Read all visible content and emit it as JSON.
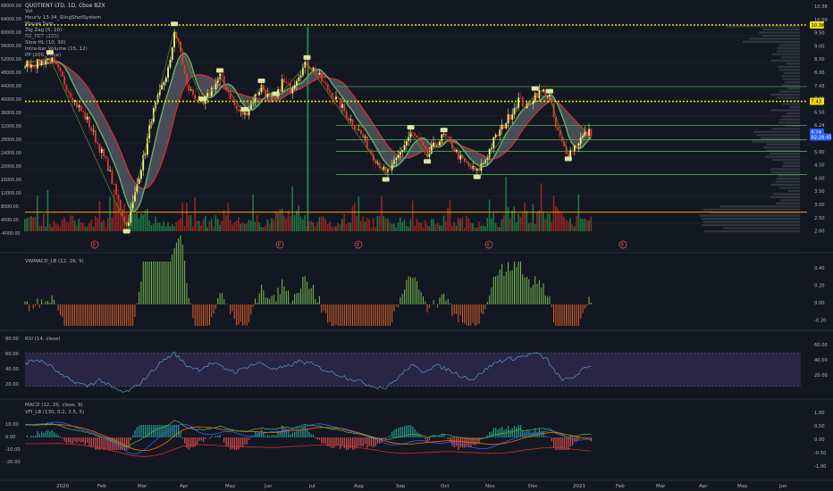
{
  "header": {
    "title": "QUOTIENT LTD, 1D, Cboe BZX",
    "indicators": [
      "Vol",
      "Hourly 13-34_SlingShotSystem",
      "Mouse Sym",
      "Zig Zag (5, 10)",
      "RB_MFP (100)",
      "Slow HL (10, 30)",
      "Intra-bar Volume (15, 12)",
      "PP (200, Price)"
    ]
  },
  "colors": {
    "background": "#131722",
    "bull": "#26a69a",
    "bear": "#ef5350",
    "vol_bull": "#1e8c45",
    "vol_bear": "#b0281e",
    "yellow_level": "#f0e20a",
    "green_level": "#4caf50",
    "orange_level": "#ff9800",
    "ma_red": "#d32f2f",
    "ma_green": "#66bb6a",
    "rsi_band": "#7e57c2",
    "rsi_line": "#5b9bd5"
  },
  "chart_data": [
    {
      "type": "candlestick",
      "title": "QUOTIENT LTD, 1D, Cboe BZX",
      "x_ticks": [
        "2020",
        "Feb",
        "Mar",
        "Apr",
        "May",
        "Jun",
        "Jul",
        "Aug",
        "Sep",
        "Oct",
        "Nov",
        "Dec",
        "2021",
        "Feb",
        "Mar",
        "Apr",
        "May",
        "Jun"
      ],
      "price_axis": [
        "10.38",
        "10.00",
        "9.50",
        "9.00",
        "8.50",
        "8.00",
        "7.43",
        "7.00",
        "6.50",
        "6.24",
        "5.50",
        "5.00",
        "4.50",
        "4.00",
        "3.50",
        "3.00",
        "2.50",
        "2.00"
      ],
      "price_badges": [
        {
          "text": "10.38",
          "price": 10.38,
          "style": "yellow"
        },
        {
          "text": "7.43",
          "price": 7.43,
          "style": "yellow"
        },
        {
          "text": "6.24",
          "price": 6.24,
          "style": "blue"
        },
        {
          "text": "02:28:45",
          "price": 6.05,
          "style": "blue"
        }
      ],
      "volume_axis": [
        "68000.00",
        "64000.00",
        "60000.00",
        "56000.00",
        "52000.00",
        "48000.00",
        "44000.00",
        "40000.00",
        "36000.00",
        "32000.00",
        "28000.00",
        "24000.00",
        "20000.00",
        "16000.00",
        "12000.00",
        "8000.00",
        "4000.00",
        "-4000.00"
      ],
      "close_series": [
        [
          0,
          8.9
        ],
        [
          5,
          8.85
        ],
        [
          9,
          9.0
        ],
        [
          12,
          9.1
        ],
        [
          16,
          8.6
        ],
        [
          20,
          8.0
        ],
        [
          25,
          7.3
        ],
        [
          30,
          6.7
        ],
        [
          35,
          5.8
        ],
        [
          40,
          4.9
        ],
        [
          44,
          3.8
        ],
        [
          47,
          3.1
        ],
        [
          49,
          2.6
        ],
        [
          52,
          3.5
        ],
        [
          55,
          4.6
        ],
        [
          58,
          5.5
        ],
        [
          61,
          6.8
        ],
        [
          64,
          7.5
        ],
        [
          67,
          8.2
        ],
        [
          70,
          8.9
        ],
        [
          72,
          10.2
        ],
        [
          75,
          9.3
        ],
        [
          78,
          8.0
        ],
        [
          82,
          7.6
        ],
        [
          86,
          7.3
        ],
        [
          90,
          7.9
        ],
        [
          94,
          8.4
        ],
        [
          98,
          7.8
        ],
        [
          102,
          7.1
        ],
        [
          106,
          6.9
        ],
        [
          110,
          7.5
        ],
        [
          114,
          8.0
        ],
        [
          118,
          7.5
        ],
        [
          121,
          7.5
        ],
        [
          124,
          8.2
        ],
        [
          128,
          7.9
        ],
        [
          132,
          8.5
        ],
        [
          136,
          8.9
        ],
        [
          140,
          8.6
        ],
        [
          144,
          8.1
        ],
        [
          148,
          7.7
        ],
        [
          152,
          7.3
        ],
        [
          156,
          6.8
        ],
        [
          160,
          6.4
        ],
        [
          164,
          5.9
        ],
        [
          168,
          5.3
        ],
        [
          172,
          4.9
        ],
        [
          174,
          4.6
        ],
        [
          178,
          5.0
        ],
        [
          182,
          5.6
        ],
        [
          186,
          6.2
        ],
        [
          190,
          5.9
        ],
        [
          194,
          5.3
        ],
        [
          198,
          5.8
        ],
        [
          202,
          6.1
        ],
        [
          206,
          5.7
        ],
        [
          210,
          5.2
        ],
        [
          214,
          4.9
        ],
        [
          218,
          4.7
        ],
        [
          222,
          5.2
        ],
        [
          226,
          5.9
        ],
        [
          230,
          6.4
        ],
        [
          234,
          6.9
        ],
        [
          238,
          7.5
        ],
        [
          242,
          7.2
        ],
        [
          246,
          7.7
        ],
        [
          250,
          7.8
        ],
        [
          253,
          7.6
        ],
        [
          256,
          6.4
        ],
        [
          259,
          5.8
        ],
        [
          262,
          5.4
        ],
        [
          265,
          5.7
        ],
        [
          268,
          6.0
        ],
        [
          271,
          6.2
        ],
        [
          273,
          6.24
        ]
      ],
      "horizontal_levels": [
        {
          "price": 10.38,
          "style": "yellow-dotted"
        },
        {
          "price": 7.43,
          "style": "yellow-dotted"
        },
        {
          "price": 8.0,
          "style": "green"
        },
        {
          "price": 6.5,
          "style": "green"
        },
        {
          "price": 5.95,
          "style": "green"
        },
        {
          "price": 5.5,
          "style": "green"
        },
        {
          "price": 4.6,
          "style": "green"
        },
        {
          "price": 3.15,
          "style": "orange"
        }
      ],
      "earnings_markers": [
        "E",
        "E",
        "E",
        "E",
        "E"
      ]
    },
    {
      "type": "histogram",
      "title": "VWMACD_LB (12, 26, 9)",
      "y_ticks": [
        "0.40",
        "0.20",
        "0.00",
        "-0.20"
      ],
      "ylim": [
        -0.25,
        0.5
      ]
    },
    {
      "type": "line",
      "title": "RSI (14, close)",
      "left_ticks": [
        "80.00",
        "60.00",
        "40.00",
        "20.00"
      ],
      "right_ticks": [
        "60.00",
        "40.00",
        "20.00"
      ],
      "bands": [
        70,
        30
      ],
      "series": [
        {
          "values": [
            [
              0,
              58
            ],
            [
              6,
              62
            ],
            [
              12,
              55
            ],
            [
              18,
              42
            ],
            [
              24,
              35
            ],
            [
              30,
              30
            ],
            [
              36,
              38
            ],
            [
              42,
              28
            ],
            [
              48,
              22
            ],
            [
              54,
              30
            ],
            [
              60,
              45
            ],
            [
              66,
              60
            ],
            [
              72,
              70
            ],
            [
              78,
              55
            ],
            [
              84,
              50
            ],
            [
              90,
              58
            ],
            [
              96,
              52
            ],
            [
              102,
              47
            ],
            [
              108,
              55
            ],
            [
              114,
              58
            ],
            [
              120,
              50
            ],
            [
              126,
              53
            ],
            [
              132,
              60
            ],
            [
              138,
              57
            ],
            [
              144,
              50
            ],
            [
              150,
              45
            ],
            [
              156,
              40
            ],
            [
              162,
              35
            ],
            [
              168,
              30
            ],
            [
              174,
              28
            ],
            [
              180,
              40
            ],
            [
              186,
              55
            ],
            [
              192,
              48
            ],
            [
              198,
              55
            ],
            [
              204,
              50
            ],
            [
              210,
              43
            ],
            [
              216,
              38
            ],
            [
              222,
              50
            ],
            [
              228,
              60
            ],
            [
              234,
              63
            ],
            [
              240,
              66
            ],
            [
              246,
              70
            ],
            [
              252,
              62
            ],
            [
              256,
              45
            ],
            [
              260,
              37
            ],
            [
              264,
              40
            ],
            [
              268,
              48
            ],
            [
              273,
              55
            ]
          ]
        }
      ]
    },
    {
      "type": "histogram",
      "title": "MACD (12, 26, close, 9)",
      "subtitle": "VFI_LB (130, 0.2, 2.5, 5)",
      "left_ticks": [
        "10.00",
        "0.00",
        "-10.00",
        "-20.00"
      ],
      "right_ticks": [
        "1.00",
        "0.50",
        "0.00",
        "-0.50",
        "-1.00"
      ]
    }
  ]
}
